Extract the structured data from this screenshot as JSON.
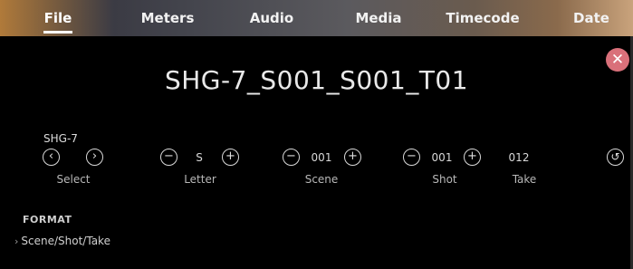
{
  "tabs": [
    {
      "label": "File",
      "active": true
    },
    {
      "label": "Meters",
      "active": false
    },
    {
      "label": "Audio",
      "active": false
    },
    {
      "label": "Media",
      "active": false
    },
    {
      "label": "Timecode",
      "active": false
    },
    {
      "label": "Date",
      "active": false
    }
  ],
  "clip": {
    "title": "SHG-7_S001_S001_T01"
  },
  "camera": {
    "name": "SHG-7",
    "select_label": "Select"
  },
  "letter": {
    "value": "S",
    "label": "Letter"
  },
  "scene": {
    "value": "001",
    "label": "Scene"
  },
  "shot": {
    "value": "001",
    "label": "Shot"
  },
  "take": {
    "value": "012",
    "label": "Take"
  },
  "format": {
    "label": "FORMAT",
    "value": "Scene/Shot/Take"
  },
  "icons": {
    "close": "close-icon",
    "prev": "chevron-left-icon",
    "next": "chevron-right-icon",
    "decrement": "minus-circle-icon",
    "increment": "plus-circle-icon",
    "reset": "reset-icon"
  },
  "colors": {
    "close_button": "#d9707a",
    "background": "#000000"
  }
}
